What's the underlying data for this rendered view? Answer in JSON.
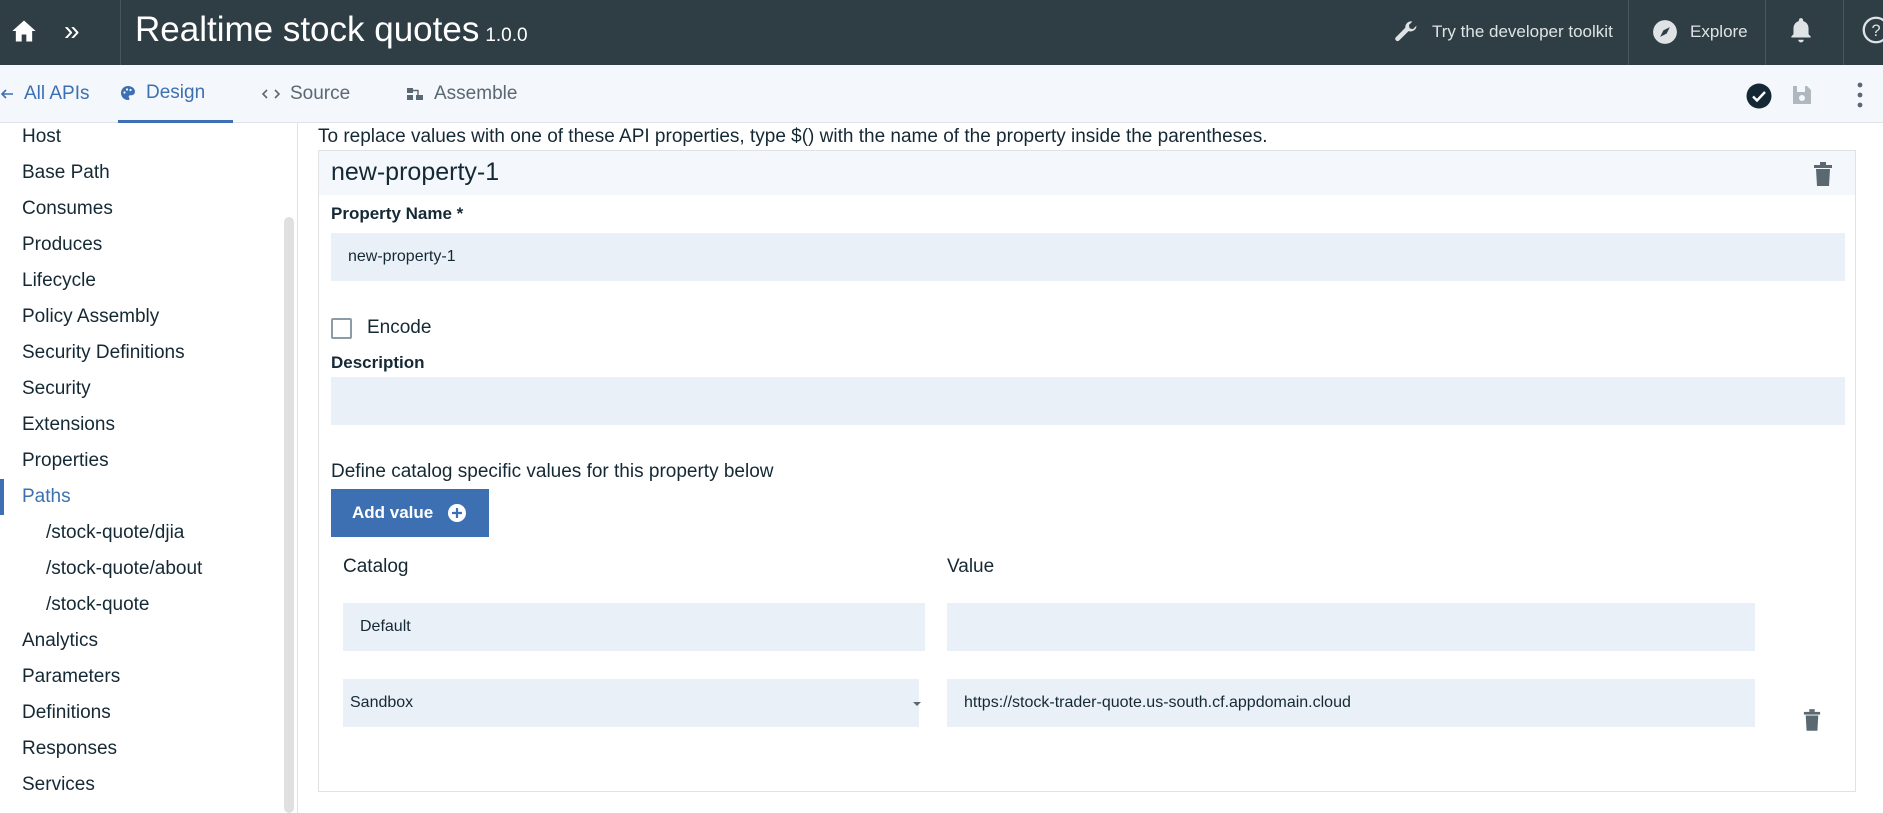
{
  "header": {
    "title": "Realtime stock quotes",
    "version": "1.0.0",
    "toolkit_label": "Try the developer toolkit",
    "explore_label": "Explore"
  },
  "tabs": {
    "back_label": "All APIs",
    "design_label": "Design",
    "source_label": "Source",
    "assemble_label": "Assemble"
  },
  "sidebar": {
    "items": [
      {
        "label": "Host"
      },
      {
        "label": "Base Path"
      },
      {
        "label": "Consumes"
      },
      {
        "label": "Produces"
      },
      {
        "label": "Lifecycle"
      },
      {
        "label": "Policy Assembly"
      },
      {
        "label": "Security Definitions"
      },
      {
        "label": "Security"
      },
      {
        "label": "Extensions"
      },
      {
        "label": "Properties"
      },
      {
        "label": "Paths",
        "active": true
      },
      {
        "label": "/stock-quote/djia",
        "sub": true
      },
      {
        "label": "/stock-quote/about",
        "sub": true
      },
      {
        "label": "/stock-quote",
        "sub": true
      },
      {
        "label": "Analytics"
      },
      {
        "label": "Parameters"
      },
      {
        "label": "Definitions"
      },
      {
        "label": "Responses"
      },
      {
        "label": "Services"
      }
    ]
  },
  "main": {
    "hint": "To replace values with one of these API properties, type $() with the name of the property inside the parentheses.",
    "property": {
      "title": "new-property-1",
      "name_label": "Property Name *",
      "name_value": "new-property-1",
      "encode_label": "Encode",
      "encode_checked": false,
      "description_label": "Description",
      "description_value": "",
      "define_text": "Define catalog specific values for this property below",
      "add_value_label": "Add value",
      "catalog_header": "Catalog",
      "value_header": "Value",
      "rows": [
        {
          "catalog": "Default",
          "value": ""
        },
        {
          "catalog": "Sandbox",
          "value": "https://stock-trader-quote.us-south.cf.appdomain.cloud"
        }
      ]
    }
  },
  "colors": {
    "topbar": "#2f3d44",
    "accent": "#3d70b2",
    "input_bg": "#eaf0f8"
  }
}
